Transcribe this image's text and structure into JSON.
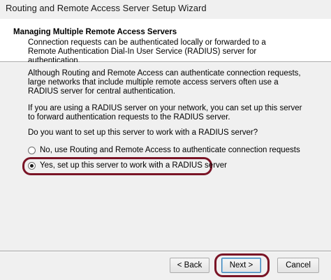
{
  "window": {
    "title": "Routing and Remote Access Server Setup Wizard"
  },
  "header": {
    "title": "Managing Multiple Remote Access Servers",
    "description": "Connection requests can be authenticated locally or forwarded to a Remote Authentication Dial-In User Service (RADIUS) server for authentication."
  },
  "body": {
    "intro": "Although Routing and Remote Access can authenticate connection requests, large networks that include multiple remote access servers often use a RADIUS server for central authentication.",
    "radius_info": "If you are using a RADIUS server on your network, you can set up this server to forward authentication requests to the RADIUS server.",
    "question": "Do you want to set up this server to work with a RADIUS server?",
    "options": [
      {
        "label": "No, use Routing and Remote Access to authenticate connection requests",
        "selected": false
      },
      {
        "label": "Yes, set up this server to work with a RADIUS server",
        "selected": true
      }
    ]
  },
  "footer": {
    "back_label": "< Back",
    "next_label": "Next >",
    "cancel_label": "Cancel"
  },
  "colors": {
    "highlight": "#7a1426",
    "default_button_border": "#3c7fb1"
  }
}
